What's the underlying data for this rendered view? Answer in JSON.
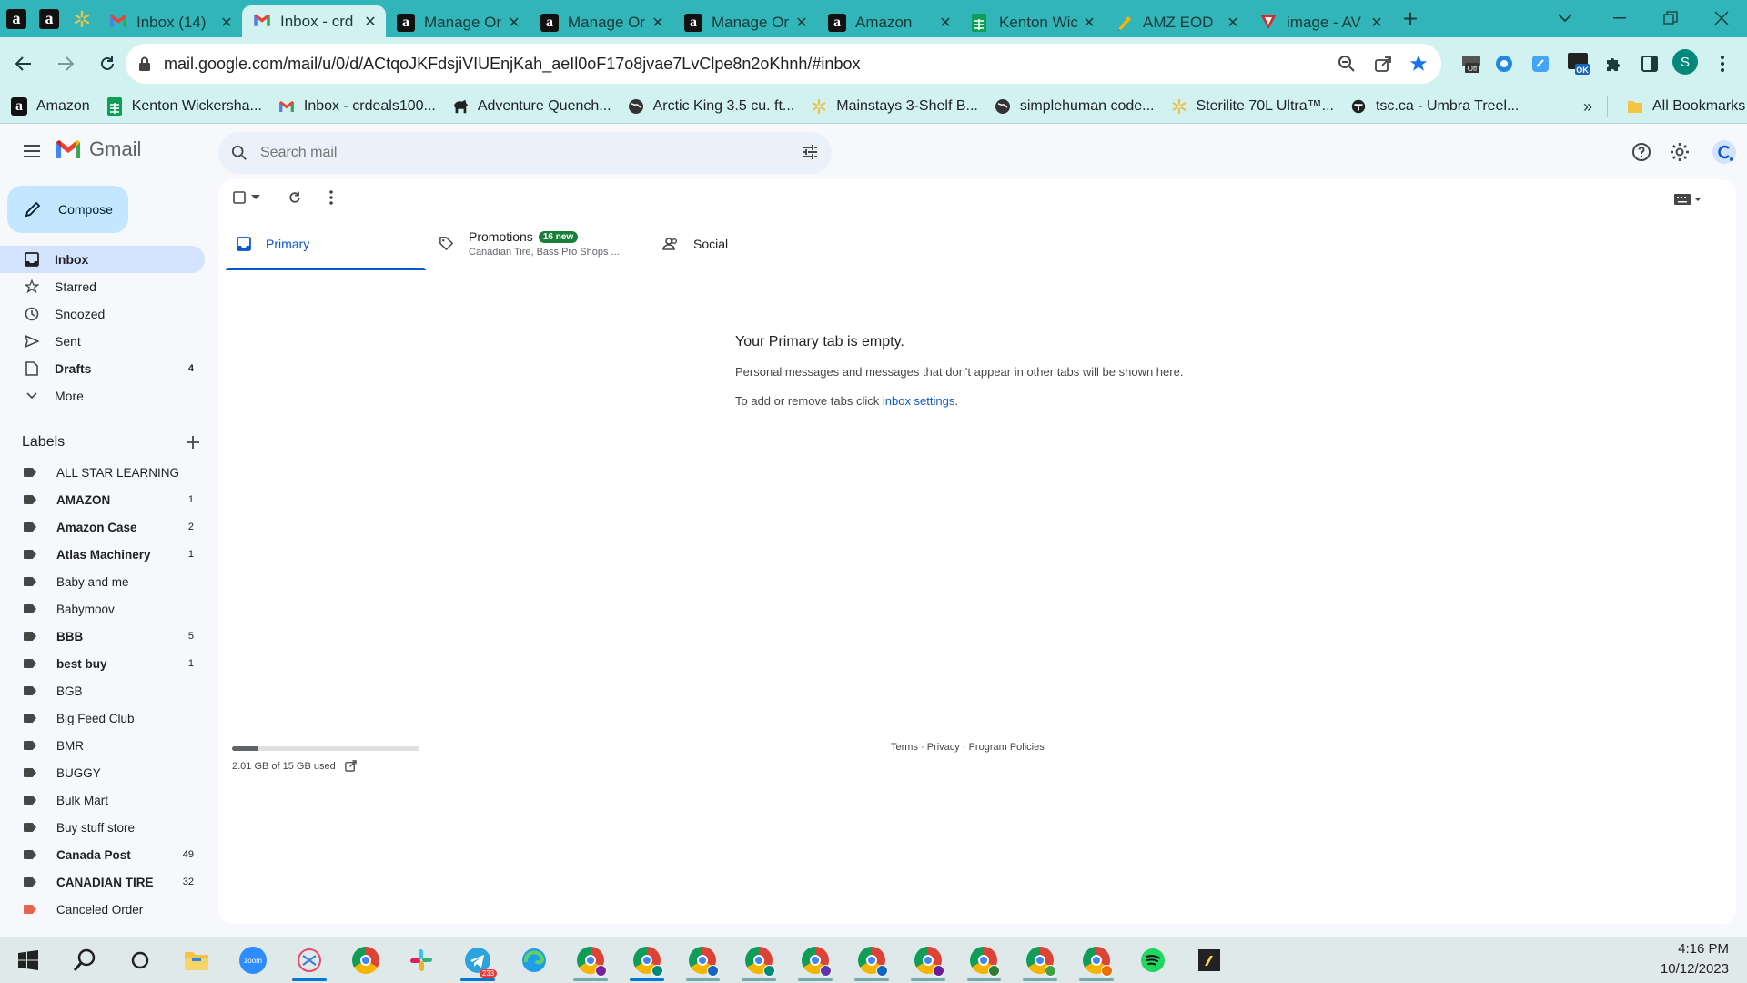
{
  "browser": {
    "tabs": [
      {
        "title": "Inbox (14)",
        "icon": "gmail-icon"
      },
      {
        "title": "Inbox - crd",
        "icon": "gmail-icon",
        "active": true
      },
      {
        "title": "Manage Or",
        "icon": "amazon-icon"
      },
      {
        "title": "Manage Or",
        "icon": "amazon-icon"
      },
      {
        "title": "Manage Or",
        "icon": "amazon-icon"
      },
      {
        "title": "Amazon",
        "icon": "amazon-icon"
      },
      {
        "title": "Kenton Wic",
        "icon": "sheets-icon"
      },
      {
        "title": "AMZ EOD",
        "icon": "amz-eod-icon"
      },
      {
        "title": "image - AV",
        "icon": "image-av-icon"
      }
    ],
    "url": "mail.google.com/mail/u/0/d/ACtqoJKFdsjiVIUEnjKah_aeIl0oF17o8jvae7LvClpe8n2oKhnh/#inbox",
    "profile_initial": "S",
    "ext_badges": {
      "off": "Off",
      "ok": "OK"
    },
    "bookmarks": [
      {
        "label": "Amazon",
        "icon": "amazon-icon"
      },
      {
        "label": "Kenton Wickersha...",
        "icon": "sheets-icon"
      },
      {
        "label": "Inbox - crdeals100...",
        "icon": "gmail-icon"
      },
      {
        "label": "Adventure Quench...",
        "icon": "animal-icon"
      },
      {
        "label": "Arctic King 3.5 cu. ft...",
        "icon": "globe-icon"
      },
      {
        "label": "Mainstays 3-Shelf B...",
        "icon": "walmart-icon"
      },
      {
        "label": "simplehuman code...",
        "icon": "globe-icon"
      },
      {
        "label": "Sterilite 70L Ultra™...",
        "icon": "walmart-icon"
      },
      {
        "label": "tsc.ca - Umbra Treel...",
        "icon": "tsc-icon"
      }
    ],
    "all_bookmarks": "All Bookmarks"
  },
  "gmail": {
    "app_name": "Gmail",
    "search_placeholder": "Search mail",
    "compose": "Compose",
    "nav": [
      {
        "label": "Inbox",
        "icon": "inbox-icon",
        "count": "",
        "active": true
      },
      {
        "label": "Starred",
        "icon": "star-icon",
        "count": ""
      },
      {
        "label": "Snoozed",
        "icon": "clock-icon",
        "count": ""
      },
      {
        "label": "Sent",
        "icon": "send-icon",
        "count": ""
      },
      {
        "label": "Drafts",
        "icon": "draft-icon",
        "count": "4",
        "bold": true
      },
      {
        "label": "More",
        "icon": "chevron-down-icon",
        "count": ""
      }
    ],
    "labels_header": "Labels",
    "labels": [
      {
        "name": "ALL STAR LEARNING",
        "count": "",
        "bold": false
      },
      {
        "name": "AMAZON",
        "count": "1",
        "bold": true
      },
      {
        "name": "Amazon Case",
        "count": "2",
        "bold": true
      },
      {
        "name": "Atlas Machinery",
        "count": "1",
        "bold": true
      },
      {
        "name": "Baby and me",
        "count": "",
        "bold": false
      },
      {
        "name": "Babymoov",
        "count": "",
        "bold": false
      },
      {
        "name": "BBB",
        "count": "5",
        "bold": true
      },
      {
        "name": "best buy",
        "count": "1",
        "bold": true
      },
      {
        "name": "BGB",
        "count": "",
        "bold": false
      },
      {
        "name": "Big Feed Club",
        "count": "",
        "bold": false
      },
      {
        "name": "BMR",
        "count": "",
        "bold": false
      },
      {
        "name": "BUGGY",
        "count": "",
        "bold": false
      },
      {
        "name": "Bulk Mart",
        "count": "",
        "bold": false
      },
      {
        "name": "Buy stuff store",
        "count": "",
        "bold": false
      },
      {
        "name": "Canada Post",
        "count": "49",
        "bold": true
      },
      {
        "name": "CANADIAN TIRE",
        "count": "32",
        "bold": true
      },
      {
        "name": "Canceled Order",
        "count": "",
        "bold": false,
        "color": "#e66550"
      }
    ],
    "inbox_tabs": [
      {
        "label": "Primary",
        "icon": "inbox-tab-icon",
        "selected": true
      },
      {
        "label": "Promotions",
        "icon": "tag-icon",
        "badge": "16 new",
        "sub": "Canadian Tire, Bass Pro Shops ..."
      },
      {
        "label": "Social",
        "icon": "people-icon"
      }
    ],
    "empty": {
      "title": "Your Primary tab is empty.",
      "line1": "Personal messages and messages that don't appear in other tabs will be shown here.",
      "line2_prefix": "To add or remove tabs click ",
      "line2_link": "inbox settings",
      "line2_suffix": "."
    },
    "storage": {
      "text": "2.01 GB of 15 GB used",
      "used_fraction": 0.134
    },
    "footer": {
      "terms": "Terms",
      "privacy": "Privacy",
      "policies": "Program Policies"
    }
  },
  "taskbar": {
    "apps": [
      "windows-start-icon",
      "search-icon",
      "cortana-icon",
      "file-explorer-icon",
      "zoom-icon",
      "snip-icon",
      "chrome-icon",
      "slack-icon",
      "telegram-icon",
      "edge-icon",
      "chrome-profile-icon",
      "chrome-profile-icon",
      "chrome-profile-icon",
      "chrome-profile-icon",
      "chrome-profile-icon",
      "chrome-profile-icon",
      "chrome-profile-icon",
      "chrome-profile-icon",
      "chrome-profile-icon",
      "chrome-profile-icon",
      "spotify-icon",
      "sticky-notes-icon"
    ],
    "telegram_badge": "233",
    "zoom_label": "zoom",
    "time": "4:16 PM",
    "date": "10/12/2023"
  },
  "colors": {
    "tabbar": "#31b5b8",
    "toolbar": "#d2f2f2",
    "gmail_bg": "#f6f8fc",
    "accent": "#0b57d0",
    "compose": "#c2e7ff",
    "badge": "#188038"
  }
}
